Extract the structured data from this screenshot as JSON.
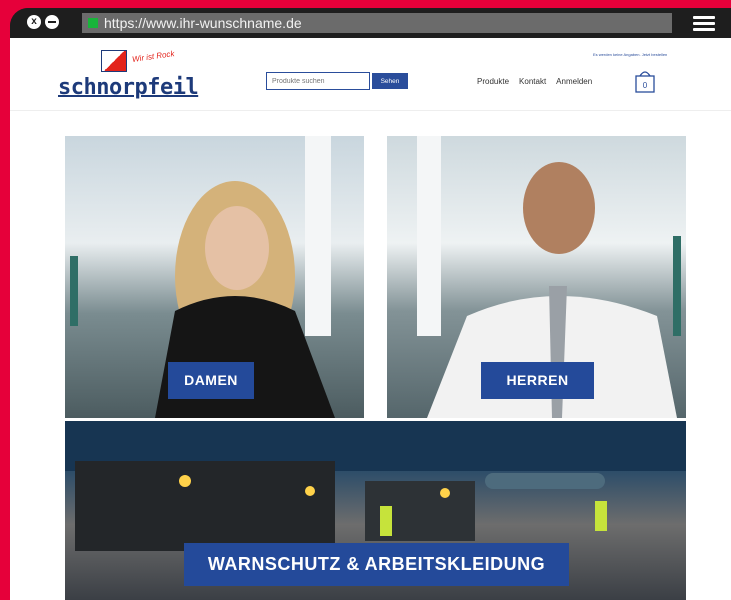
{
  "browser": {
    "url": "https://www.ihr-wunschname.de",
    "close_glyph": "x"
  },
  "brand": {
    "logo_text": "schnorpfeil",
    "tagline": "Wir ist Rock",
    "colors": {
      "accent": "#e6003a",
      "brand_blue": "#244a9a",
      "logo_red": "#e3231b"
    }
  },
  "header": {
    "top_note": "Es werden keine Angaben. Jetzt bestellen",
    "search_placeholder": "Produkte suchen",
    "search_button": "Sehen",
    "nav": [
      "Produkte",
      "Kontakt",
      "Anmelden"
    ],
    "cart_count": "0"
  },
  "tiles": [
    {
      "label": "DAMEN"
    },
    {
      "label": "HERREN"
    },
    {
      "label": "WARNSCHUTZ & ARBEITSKLEIDUNG"
    }
  ],
  "icons": [
    "close-icon",
    "minimize-icon",
    "secure-lock-icon",
    "hamburger-menu-icon",
    "cart-icon"
  ]
}
